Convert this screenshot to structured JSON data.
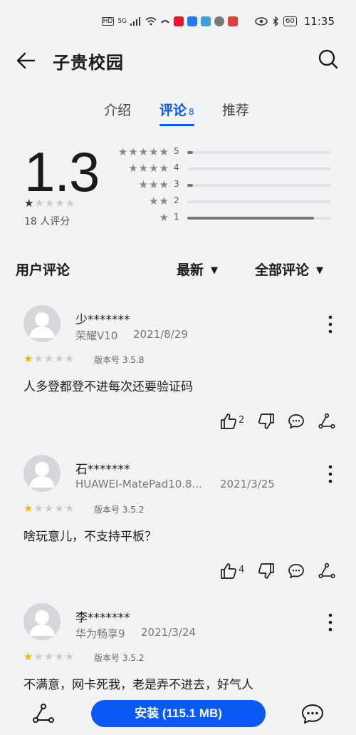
{
  "status_bar": {
    "hd": "HD",
    "signal": "5G",
    "battery": "60",
    "time": "11:35"
  },
  "header": {
    "title": "子贵校园"
  },
  "tabs": {
    "intro": "介绍",
    "reviews": "评论",
    "reviews_count": "8",
    "recommend": "推荐"
  },
  "rating": {
    "score": "1.3",
    "count_label": "18 人评分",
    "stars_value": 1.3,
    "distribution": [
      {
        "stars": "5",
        "fraction": 0.04
      },
      {
        "stars": "4",
        "fraction": 0.0
      },
      {
        "stars": "3",
        "fraction": 0.04
      },
      {
        "stars": "2",
        "fraction": 0.0
      },
      {
        "stars": "1",
        "fraction": 0.88
      }
    ]
  },
  "reviews_header": {
    "title": "用户评论",
    "sort": "最新",
    "filter": "全部评论"
  },
  "reviews": [
    {
      "name": "少*******",
      "device": "荣耀V10",
      "date": "2021/8/29",
      "stars": 1,
      "version": "版本号 3.5.8",
      "content": "人多登都登不进每次还要验证码",
      "likes": "2"
    },
    {
      "name": "石*******",
      "device": "HUAWEI-MatePad10.8...",
      "date": "2021/3/25",
      "stars": 1,
      "version": "版本号 3.5.2",
      "content": "啥玩意儿，不支持平板？",
      "likes": "4"
    },
    {
      "name": "李*******",
      "device": "华为畅享9",
      "date": "2021/3/24",
      "stars": 1,
      "version": "版本号 3.5.2",
      "content": "不满意，网卡死我，老是弄不进去，好气人",
      "likes": ""
    }
  ],
  "bottom_bar": {
    "install": "安装 (115.1 MB)"
  },
  "colors": {
    "accent": "#0a59f7",
    "star_gold": "#f7b500",
    "background": "#f1f3f5"
  }
}
